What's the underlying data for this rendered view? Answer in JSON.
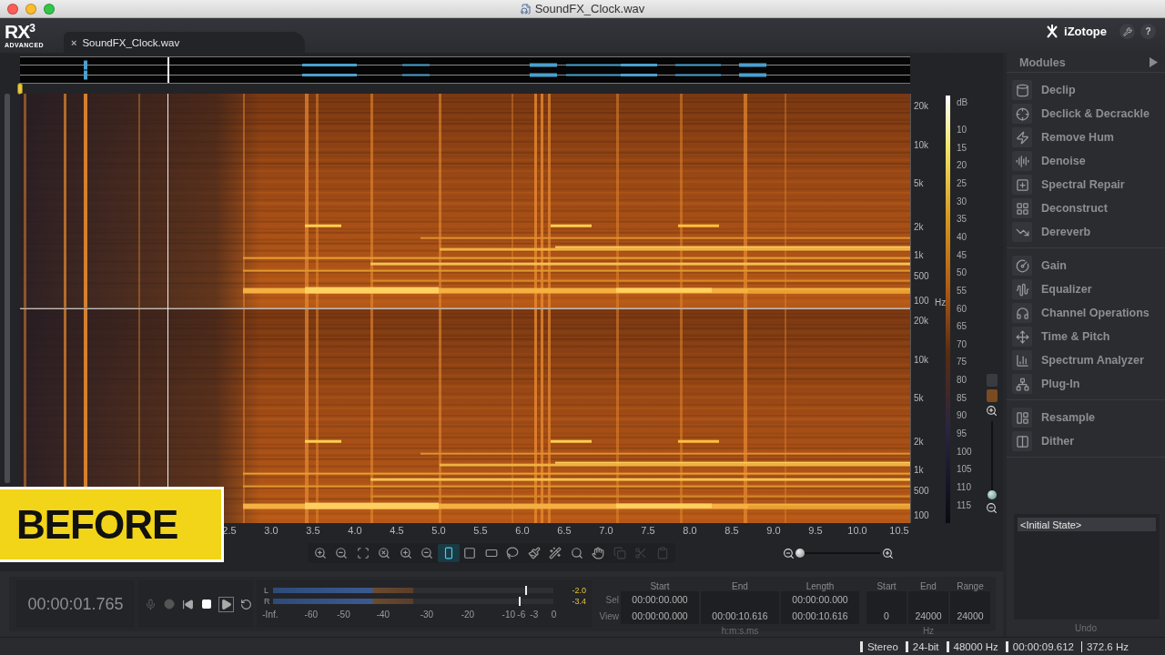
{
  "window": {
    "title": "SoundFX_Clock.wav"
  },
  "app": {
    "logo": "RX",
    "logo_version": "3",
    "edition": "ADVANCED",
    "brand": "iZotope",
    "help_button": "?"
  },
  "tabs": [
    {
      "label": "SoundFX_Clock.wav",
      "close": "×",
      "selected": true
    }
  ],
  "playhead": {
    "level": 0.166
  },
  "freq_axes": [
    {
      "labels": [
        "20k",
        "10k",
        "5k",
        "2k",
        "1k",
        "500",
        "100"
      ],
      "unit": "Hz"
    },
    {
      "labels": [
        "20k",
        "10k",
        "5k",
        "2k",
        "1k",
        "500",
        "100"
      ]
    }
  ],
  "db_scale": {
    "unit": "dB",
    "labels": [
      "10",
      "15",
      "20",
      "25",
      "30",
      "35",
      "40",
      "45",
      "50",
      "55",
      "60",
      "65",
      "70",
      "75",
      "80",
      "85",
      "90",
      "95",
      "100",
      "105",
      "110",
      "115"
    ]
  },
  "time_axis": [
    "2.5",
    "3.0",
    "3.5",
    "4.0",
    "4.5",
    "5.0",
    "5.5",
    "6.0",
    "6.5",
    "7.0",
    "7.5",
    "8.0",
    "8.5",
    "9.0",
    "9.5",
    "10.0",
    "10.5"
  ],
  "tools": [
    {
      "selected": false,
      "disabled": false
    },
    {
      "selected": false,
      "disabled": false
    },
    {
      "selected": false,
      "disabled": false
    },
    {
      "selected": false,
      "disabled": false
    },
    {
      "selected": false,
      "disabled": false
    },
    {
      "selected": false,
      "disabled": false
    },
    {
      "selected": true,
      "disabled": false
    },
    {
      "selected": false,
      "disabled": false
    },
    {
      "selected": false,
      "disabled": false
    },
    {
      "selected": false,
      "disabled": false
    },
    {
      "selected": false,
      "disabled": false
    },
    {
      "selected": false,
      "disabled": false
    },
    {
      "selected": false,
      "disabled": false
    },
    {
      "selected": false,
      "disabled": false
    },
    {
      "selected": false,
      "disabled": true
    },
    {
      "selected": false,
      "disabled": true
    },
    {
      "selected": false,
      "disabled": true
    }
  ],
  "zoom": {
    "horizontal": {
      "level": 0.05
    },
    "vertical": {
      "level": 0.04
    }
  },
  "transport": {
    "time": "00:00:01.765"
  },
  "meter": {
    "channels": [
      {
        "name": "L",
        "level": 0.5,
        "peak": {
          "level": 0.9
        },
        "reading": "-2.0"
      },
      {
        "name": "R",
        "level": 0.5,
        "peak": {
          "level": 0.88
        },
        "reading": "-3.4"
      }
    ],
    "scale": [
      "-Inf.",
      "-60",
      "-50",
      "-40",
      "-30",
      "-20",
      "-10",
      "-6",
      "-3",
      "0"
    ]
  },
  "time_selection": {
    "columns": [
      "Start",
      "End",
      "Length"
    ],
    "rows": [
      {
        "label": "Sel",
        "start": "00:00:00.000",
        "length": "00:00:00.000"
      },
      {
        "label": "View",
        "start": "00:00:00.000",
        "end": "00:00:10.616",
        "length": "00:00:10.616"
      }
    ],
    "unit": "h:m:s.ms"
  },
  "freq_selection": {
    "columns": [
      "Start",
      "End",
      "Range"
    ],
    "view": {
      "start": "0",
      "end": "24000",
      "range": "24000"
    },
    "unit": "Hz"
  },
  "modules": {
    "title": "Modules",
    "groups": [
      {
        "items": [
          "Declip",
          "Declick & Decrackle",
          "Remove Hum",
          "Denoise",
          "Spectral Repair",
          "Deconstruct",
          "Dereverb"
        ]
      },
      {
        "items": [
          "Gain",
          "Equalizer",
          "Channel Operations",
          "Time & Pitch",
          "Spectrum Analyzer",
          "Plug-In"
        ]
      },
      {
        "items": [
          "Resample",
          "Dither"
        ]
      }
    ]
  },
  "undo": {
    "title": "Undo",
    "items": [
      {
        "label": "<Initial State>",
        "selected": true
      }
    ]
  },
  "status_bar": [
    "Stereo",
    "24-bit",
    "48000 Hz",
    "00:00:09.612",
    "372.6 Hz"
  ],
  "badge": "BEFORE"
}
